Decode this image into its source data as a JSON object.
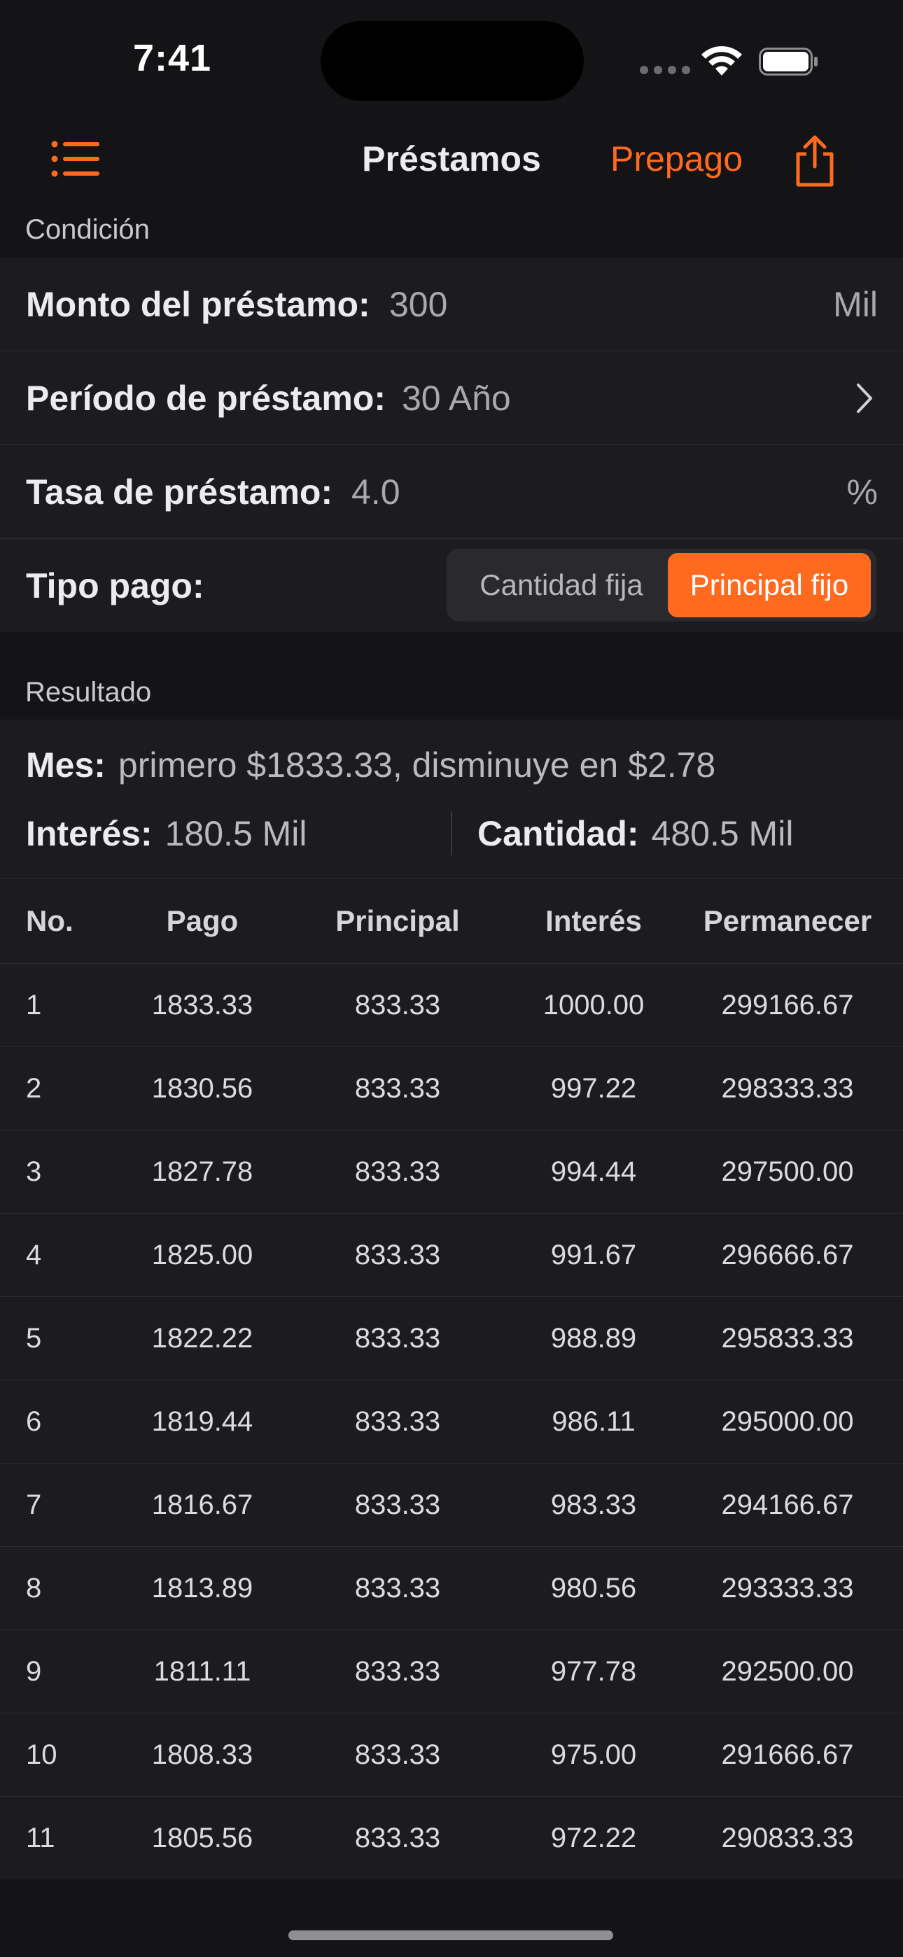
{
  "status": {
    "time": "7:41"
  },
  "nav": {
    "title": "Préstamos",
    "prepay": "Prepago"
  },
  "condition": {
    "header": "Condición",
    "amount_label": "Monto del préstamo:",
    "amount_value": "300",
    "amount_unit": "Mil",
    "period_label": "Período de préstamo:",
    "period_value": "30 Año",
    "rate_label": "Tasa de préstamo:",
    "rate_value": "4.0",
    "rate_unit": "%",
    "type_label": "Tipo pago:",
    "type_options": [
      "Cantidad fija",
      "Principal fijo"
    ],
    "type_selected": "Principal fijo"
  },
  "result": {
    "header": "Resultado",
    "month_label": "Mes:",
    "month_value": "primero $1833.33, disminuye en $2.78",
    "interest_label": "Interés:",
    "interest_value": "180.5 Mil",
    "total_label": "Cantidad:",
    "total_value": "480.5 Mil"
  },
  "table": {
    "columns": [
      "No.",
      "Pago",
      "Principal",
      "Interés",
      "Permanecer"
    ],
    "rows": [
      [
        "1",
        "1833.33",
        "833.33",
        "1000.00",
        "299166.67"
      ],
      [
        "2",
        "1830.56",
        "833.33",
        "997.22",
        "298333.33"
      ],
      [
        "3",
        "1827.78",
        "833.33",
        "994.44",
        "297500.00"
      ],
      [
        "4",
        "1825.00",
        "833.33",
        "991.67",
        "296666.67"
      ],
      [
        "5",
        "1822.22",
        "833.33",
        "988.89",
        "295833.33"
      ],
      [
        "6",
        "1819.44",
        "833.33",
        "986.11",
        "295000.00"
      ],
      [
        "7",
        "1816.67",
        "833.33",
        "983.33",
        "294166.67"
      ],
      [
        "8",
        "1813.89",
        "833.33",
        "980.56",
        "293333.33"
      ],
      [
        "9",
        "1811.11",
        "833.33",
        "977.78",
        "292500.00"
      ],
      [
        "10",
        "1808.33",
        "833.33",
        "975.00",
        "291666.67"
      ],
      [
        "11",
        "1805.56",
        "833.33",
        "972.22",
        "290833.33"
      ]
    ]
  },
  "colors": {
    "accent": "#ff6a1f",
    "background": "#141416",
    "surface": "#1c1c1f"
  },
  "icons": [
    "list-icon",
    "share-icon",
    "chevron-right-icon",
    "wifi-icon",
    "battery-icon"
  ]
}
